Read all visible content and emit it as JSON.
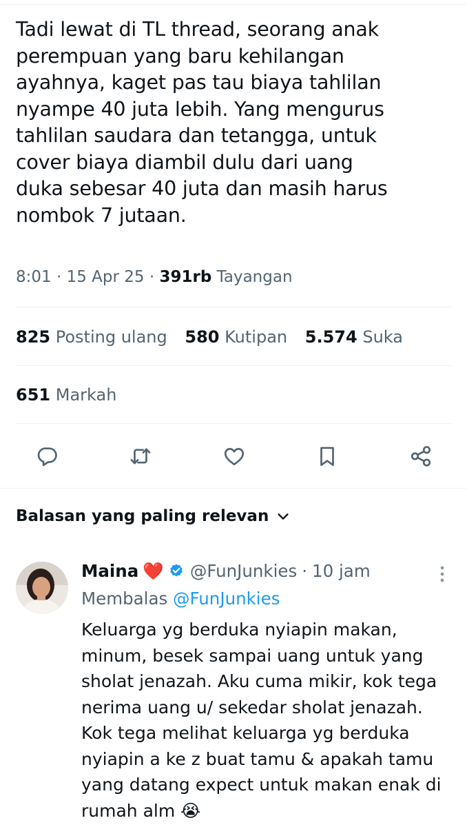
{
  "tweet": {
    "text": "Tadi lewat di TL thread, seorang anak\nperempuan yang baru kehilangan\nayahnya, kaget pas tau biaya tahlilan\nnyampe 40 juta lebih. Yang mengurus\ntahlilan saudara dan tetangga, untuk\ncover biaya diambil dulu dari uang\nduka sebesar 40 juta dan masih harus\nnombok 7 jutaan.",
    "time": "8:01",
    "date": "15 Apr 25",
    "views_count": "391rb",
    "views_label": "Tayangan",
    "separator": "·"
  },
  "stats": {
    "reposts_count": "825",
    "reposts_label": "Posting ulang",
    "quotes_count": "580",
    "quotes_label": "Kutipan",
    "likes_count": "5.574",
    "likes_label": "Suka",
    "bookmarks_count": "651",
    "bookmarks_label": "Markah"
  },
  "actions": [
    {
      "name": "reply-icon"
    },
    {
      "name": "repost-icon"
    },
    {
      "name": "like-icon"
    },
    {
      "name": "bookmark-icon"
    },
    {
      "name": "share-icon"
    }
  ],
  "colors": {
    "accent": "#1d9bf0",
    "text": "#0f1419",
    "secondary": "#536471",
    "divider": "#eff3f4"
  },
  "sort": {
    "label": "Balasan yang paling relevan"
  },
  "reply": {
    "name": "Maina",
    "heart": "❤️",
    "handle": "@FunJunkies",
    "separator": "·",
    "age": "10 jam",
    "replying_prefix": "Membalas",
    "replying_handle": "@FunJunkies",
    "text": "Keluarga yg berduka nyiapin makan,\nminum, besek sampai uang untuk yang\nsholat jenazah. Aku cuma mikir, kok tega\nnerima uang u/ sekedar sholat jenazah.\nKok tega melihat keluarga yg berduka\nnyiapin a ke z buat tamu & apakah tamu\nyang datang expect untuk makan enak di\nrumah alm 😭"
  }
}
